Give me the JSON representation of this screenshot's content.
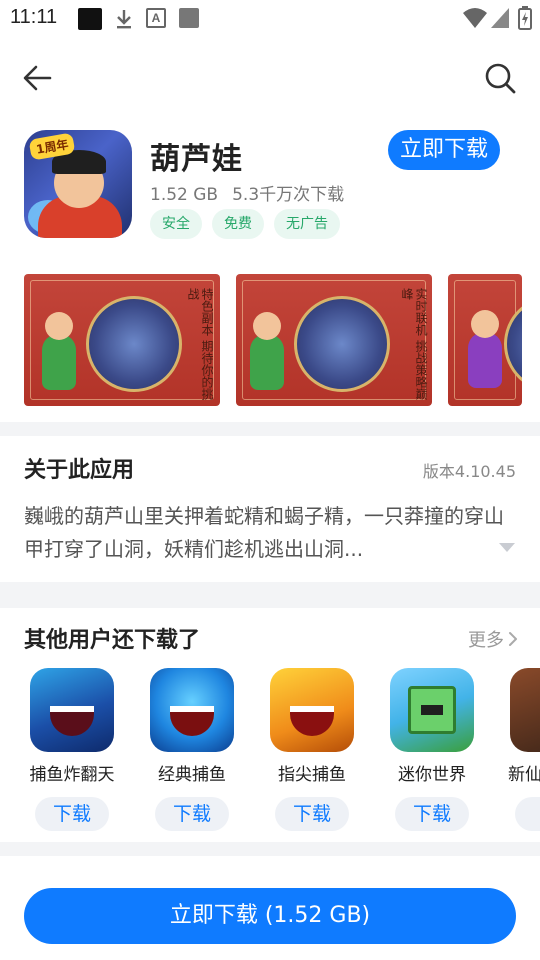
{
  "status_bar": {
    "time": "11:11",
    "icons": [
      "notification-icon",
      "download-icon",
      "font-icon",
      "app-icon",
      "wifi-icon",
      "signal-icon",
      "battery-icon"
    ]
  },
  "toolbar": {
    "back_icon": "back-arrow-icon",
    "search_icon": "search-icon"
  },
  "app": {
    "name": "葫芦娃",
    "icon_badge": "1周年",
    "size": "1.52 GB",
    "downloads": "5.3千万次下载",
    "install_label": "立即下载",
    "tags": [
      "安全",
      "免费",
      "无广告"
    ]
  },
  "screenshots": [
    {
      "caption": "特色副本 期待你的挑战"
    },
    {
      "caption": "实时联机 挑战策略巅峰"
    },
    {
      "caption": ""
    }
  ],
  "about": {
    "title": "关于此应用",
    "version": "版本4.10.45",
    "description": "巍峨的葫芦山里关押着蛇精和蝎子精，一只莽撞的穿山甲打穿了山洞，妖精们趁机逃出山洞..."
  },
  "also_downloaded": {
    "title": "其他用户还下载了",
    "more_label": "更多",
    "items": [
      {
        "name": "捕鱼炸翻天",
        "button": "下载"
      },
      {
        "name": "经典捕鱼",
        "button": "下载"
      },
      {
        "name": "指尖捕鱼",
        "button": "下载"
      },
      {
        "name": "迷你世界",
        "button": "下载"
      },
      {
        "name": "新仙",
        "button": ""
      }
    ]
  },
  "bottom_bar": {
    "install_label": "立即下载 (1.52 GB)"
  },
  "colors": {
    "accent": "#0f7bff",
    "tag_bg": "#e9f7f1",
    "tag_text": "#27a86a",
    "section_divider": "#f3f4f6"
  }
}
